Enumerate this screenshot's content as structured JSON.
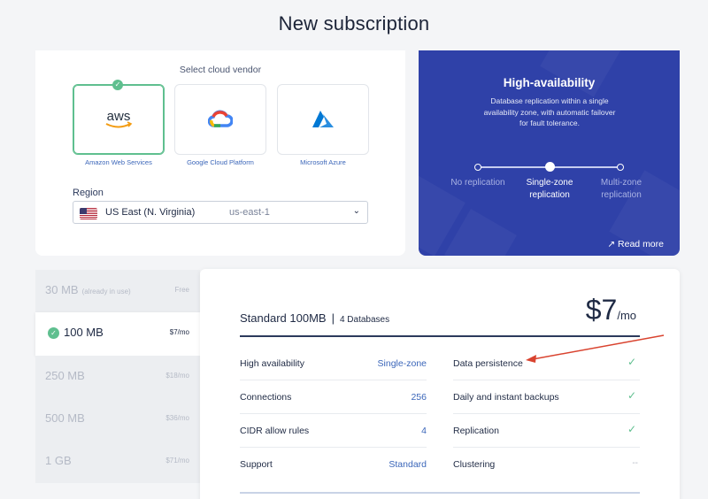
{
  "page": {
    "title": "New subscription"
  },
  "vendor": {
    "title": "Select cloud vendor",
    "options": [
      {
        "name": "Amazon Web Services",
        "logo_text": "aws",
        "selected": true
      },
      {
        "name": "Google Cloud Platform",
        "selected": false
      },
      {
        "name": "Microsoft Azure",
        "selected": false
      }
    ]
  },
  "region": {
    "label": "Region",
    "name": "US East (N. Virginia)",
    "code": "us-east-1"
  },
  "ha": {
    "title": "High-availability",
    "description": "Database replication within a single availability zone, with automatic failover for fault tolerance.",
    "options": [
      "No replication",
      "Single-zone\nreplication",
      "Multi-zone\nreplication"
    ],
    "selected": "Single-zone replication",
    "read_more": "Read more"
  },
  "plans": [
    {
      "name": "30 MB",
      "note": "(already in use)",
      "price": "Free",
      "state": "faded"
    },
    {
      "name": "100 MB",
      "price": "$7/mo",
      "state": "active"
    },
    {
      "name": "250 MB",
      "price": "$18/mo",
      "state": "normal"
    },
    {
      "name": "500 MB",
      "price": "$36/mo",
      "state": "normal"
    },
    {
      "name": "1 GB",
      "price": "$71/mo",
      "state": "normal"
    }
  ],
  "detail": {
    "title": "Standard 100MB",
    "separator": "|",
    "subtitle": "4 Databases",
    "price": "$7",
    "price_unit": "/mo",
    "left_rows": [
      {
        "label": "High availability",
        "value": "Single-zone"
      },
      {
        "label": "Connections",
        "value": "256"
      },
      {
        "label": "CIDR allow rules",
        "value": "4"
      },
      {
        "label": "Support",
        "value": "Standard"
      }
    ],
    "right_rows": [
      {
        "label": "Data persistence",
        "value": "✓"
      },
      {
        "label": "Daily and instant backups",
        "value": "✓"
      },
      {
        "label": "Replication",
        "value": "✓"
      },
      {
        "label": "Clustering",
        "value": "--"
      }
    ]
  },
  "colors": {
    "accent_blue": "#2f41a8",
    "success_green": "#5fbf8f",
    "annotation_red": "#d9432f"
  }
}
